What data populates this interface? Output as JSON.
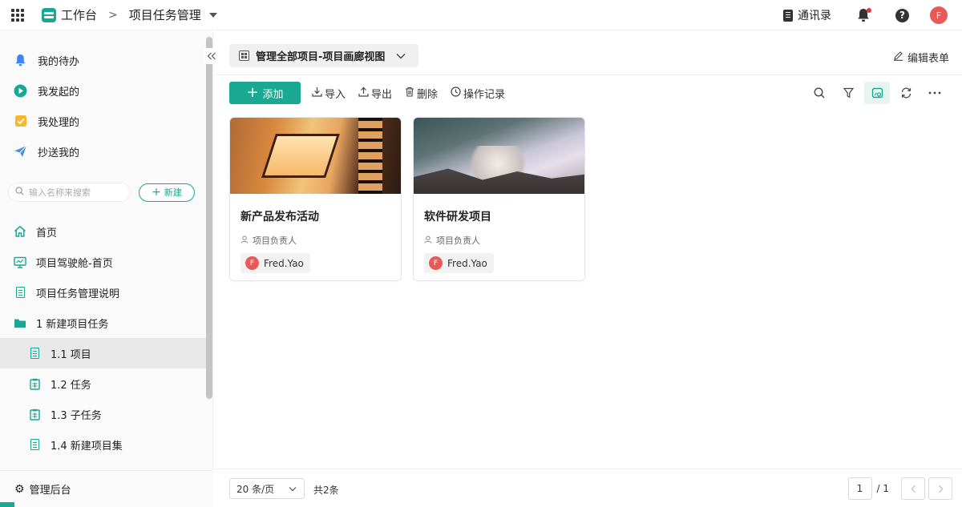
{
  "topbar": {
    "workspace_title": "工作台",
    "separator": ">",
    "project_title": "项目任务管理",
    "contacts_label": "通讯录",
    "help_glyph": "?",
    "user_initial": "F"
  },
  "sidebar": {
    "quick_items": [
      {
        "label": "我的待办",
        "icon": "bell-icon",
        "color": "#3b86f6"
      },
      {
        "label": "我发起的",
        "icon": "play-icon",
        "color": "#1aa892"
      },
      {
        "label": "我处理的",
        "icon": "check-icon",
        "color": "#f5b82e"
      },
      {
        "label": "抄送我的",
        "icon": "send-icon",
        "color": "#4a90e2"
      }
    ],
    "search_placeholder": "输入名称来搜索",
    "new_button": "新建",
    "tree": [
      {
        "label": "首页",
        "icon": "home-icon"
      },
      {
        "label": "项目驾驶舱-首页",
        "icon": "dashboard-icon"
      },
      {
        "label": "项目任务管理说明",
        "icon": "document-icon"
      },
      {
        "label": "1 新建项目任务",
        "icon": "folder-icon"
      },
      {
        "label": "1.1 项目",
        "icon": "document-icon"
      },
      {
        "label": "1.2 任务",
        "icon": "form-icon"
      },
      {
        "label": "1.3 子任务",
        "icon": "form-icon"
      },
      {
        "label": "1.4 新建项目集",
        "icon": "document-icon"
      }
    ],
    "admin_label": "管理后台"
  },
  "main": {
    "view_name": "管理全部项目-项目画廊视图",
    "edit_form_label": "编辑表单",
    "toolbar": {
      "add_label": "添加",
      "import_label": "导入",
      "export_label": "导出",
      "delete_label": "删除",
      "log_label": "操作记录"
    },
    "cards": [
      {
        "title": "新产品发布活动",
        "owner_label": "项目负责人",
        "owner_name": "Fred.Yao",
        "owner_initial": "F"
      },
      {
        "title": "软件研发项目",
        "owner_label": "项目负责人",
        "owner_name": "Fred.Yao",
        "owner_initial": "F"
      }
    ],
    "footer": {
      "page_size": "20 条/页",
      "total": "共2条",
      "current_page": "1",
      "total_pages": "/ 1"
    }
  },
  "colors": {
    "accent": "#1aa892",
    "avatar": "#e85a5a",
    "notification_dot": "#e4393c"
  }
}
